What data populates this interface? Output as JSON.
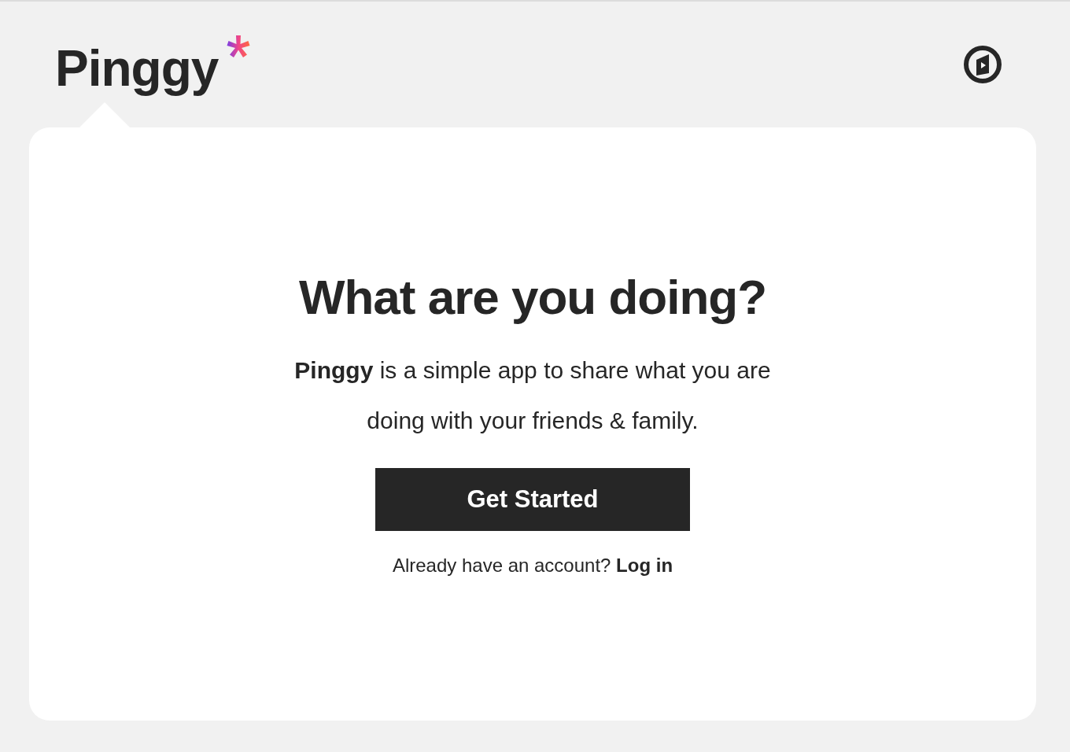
{
  "header": {
    "logo": "Pinggy"
  },
  "card": {
    "title": "What are you doing?",
    "description": "**Pinggy** is a simple app to share what you are doing with your friends & family.",
    "button": "Get Started",
    "login_prompt": "Already have an account?",
    "login_link": "Log in"
  }
}
